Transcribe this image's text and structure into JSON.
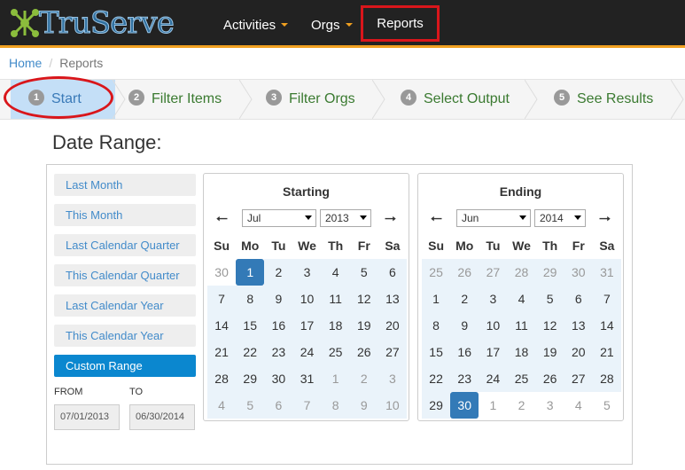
{
  "brand": {
    "name": "TruServe"
  },
  "nav": {
    "activities": "Activities",
    "orgs": "Orgs",
    "reports": "Reports"
  },
  "breadcrumb": {
    "home": "Home",
    "current": "Reports"
  },
  "wizard": {
    "steps": [
      {
        "num": "1",
        "label": "Start"
      },
      {
        "num": "2",
        "label": "Filter Items"
      },
      {
        "num": "3",
        "label": "Filter Orgs"
      },
      {
        "num": "4",
        "label": "Select Output"
      },
      {
        "num": "5",
        "label": "See Results"
      }
    ],
    "active_step": "1"
  },
  "date_range": {
    "title": "Date Range:",
    "presets": [
      "Last Month",
      "This Month",
      "Last Calendar Quarter",
      "This Calendar Quarter",
      "Last Calendar Year",
      "This Calendar Year",
      "Custom Range"
    ],
    "active_preset": "Custom Range",
    "from_label": "FROM",
    "to_label": "TO",
    "from_value": "07/01/2013",
    "to_value": "06/30/2014"
  },
  "calendars": {
    "weekdays": [
      "Su",
      "Mo",
      "Tu",
      "We",
      "Th",
      "Fr",
      "Sa"
    ],
    "starting": {
      "title": "Starting",
      "month": "Jul",
      "year": "2013",
      "weeks": [
        [
          "30",
          "1",
          "2",
          "3",
          "4",
          "5",
          "6"
        ],
        [
          "7",
          "8",
          "9",
          "10",
          "11",
          "12",
          "13"
        ],
        [
          "14",
          "15",
          "16",
          "17",
          "18",
          "19",
          "20"
        ],
        [
          "21",
          "22",
          "23",
          "24",
          "25",
          "26",
          "27"
        ],
        [
          "28",
          "29",
          "30",
          "31",
          "1",
          "2",
          "3"
        ],
        [
          "4",
          "5",
          "6",
          "7",
          "8",
          "9",
          "10"
        ]
      ]
    },
    "ending": {
      "title": "Ending",
      "month": "Jun",
      "year": "2014",
      "weeks": [
        [
          "25",
          "26",
          "27",
          "28",
          "29",
          "30",
          "31"
        ],
        [
          "1",
          "2",
          "3",
          "4",
          "5",
          "6",
          "7"
        ],
        [
          "8",
          "9",
          "10",
          "11",
          "12",
          "13",
          "14"
        ],
        [
          "15",
          "16",
          "17",
          "18",
          "19",
          "20",
          "21"
        ],
        [
          "22",
          "23",
          "24",
          "25",
          "26",
          "27",
          "28"
        ],
        [
          "29",
          "30",
          "1",
          "2",
          "3",
          "4",
          "5"
        ]
      ]
    }
  },
  "colors": {
    "nav_bg": "#222222",
    "nav_accent": "#f0a020",
    "annotation_red": "#d9161b",
    "active_step_bg": "#c4dff7",
    "custom_range_bg": "#0b87cf",
    "selected_day_bg": "#337ab7",
    "in_range_bg": "#eaf3fa"
  }
}
